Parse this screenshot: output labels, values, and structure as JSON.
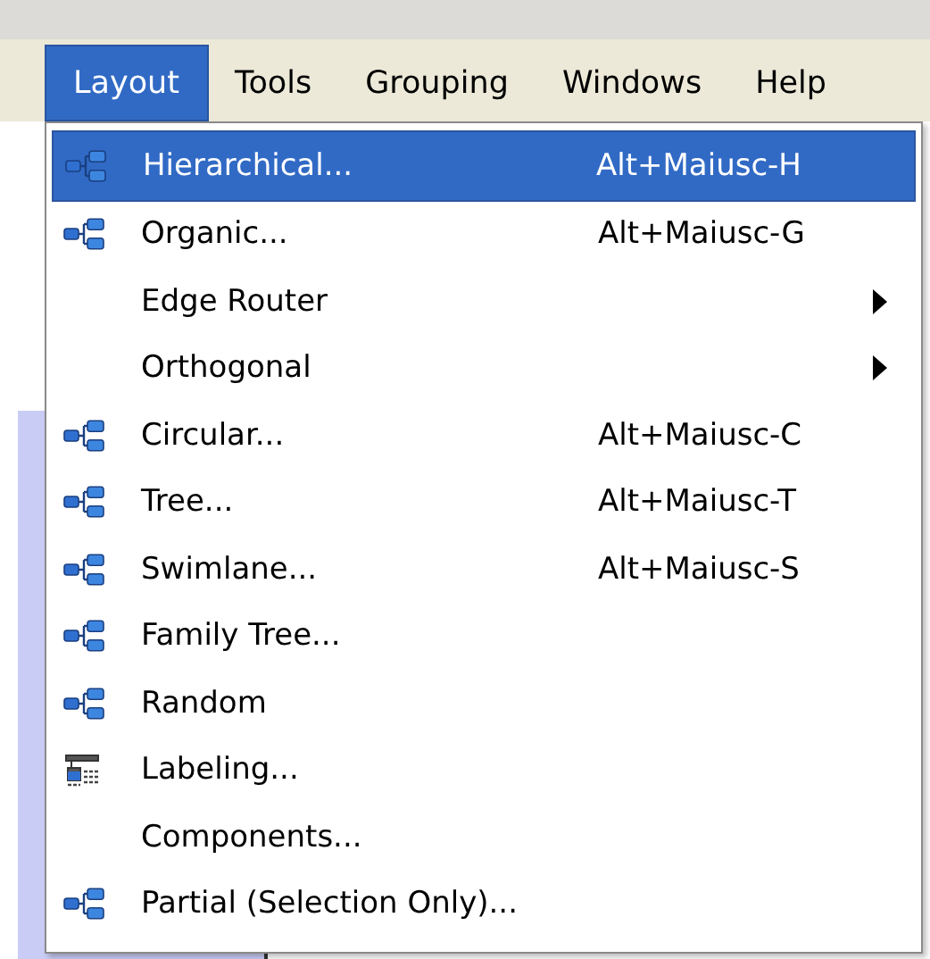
{
  "menubar": [
    {
      "label": "Layout",
      "selected": true
    },
    {
      "label": "Tools",
      "selected": false
    },
    {
      "label": "Grouping",
      "selected": false
    },
    {
      "label": "Windows",
      "selected": false
    },
    {
      "label": "Help",
      "selected": false
    }
  ],
  "menu": {
    "items": [
      {
        "label": "Hierarchical...",
        "shortcut": "Alt+Maiusc-H",
        "kind": "layout",
        "submenu": false,
        "selected": true
      },
      {
        "label": "Organic...",
        "shortcut": "Alt+Maiusc-G",
        "kind": "layout",
        "submenu": false,
        "selected": false
      },
      {
        "label": "Edge Router",
        "submenu": true,
        "selected": false
      },
      {
        "label": "Orthogonal",
        "submenu": true,
        "selected": false
      },
      {
        "label": "Circular...",
        "shortcut": "Alt+Maiusc-C",
        "kind": "layout",
        "submenu": false,
        "selected": false
      },
      {
        "label": "Tree...",
        "shortcut": "Alt+Maiusc-T",
        "kind": "layout",
        "submenu": false,
        "selected": false
      },
      {
        "label": "Swimlane...",
        "shortcut": "Alt+Maiusc-S",
        "kind": "layout",
        "submenu": false,
        "selected": false
      },
      {
        "label": "Family Tree...",
        "kind": "layout",
        "submenu": false,
        "selected": false
      },
      {
        "label": "Random",
        "kind": "layout",
        "submenu": false,
        "selected": false
      },
      {
        "label": "Labeling...",
        "kind": "labeling",
        "submenu": false,
        "selected": false
      },
      {
        "label": "Components...",
        "submenu": false,
        "selected": false
      },
      {
        "label": "Partial (Selection Only)...",
        "kind": "layout",
        "submenu": false,
        "selected": false
      }
    ]
  }
}
